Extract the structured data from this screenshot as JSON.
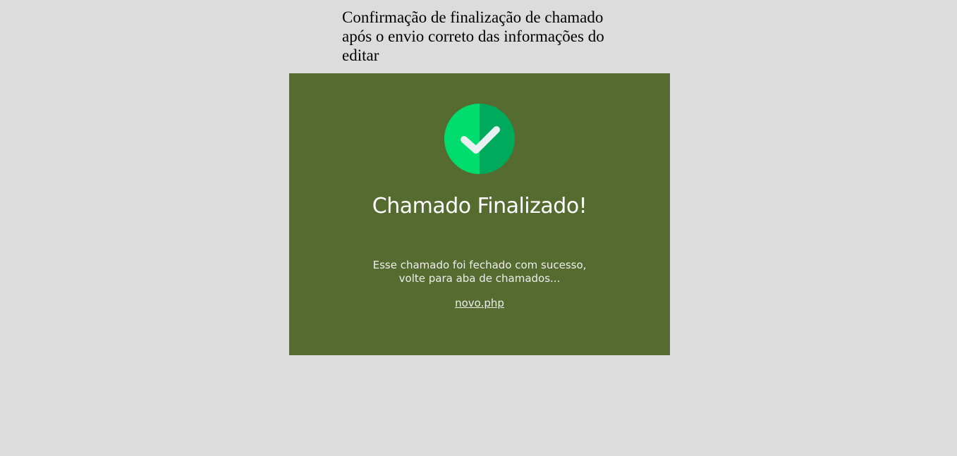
{
  "page": {
    "heading": "Confirmação de finalização de chamado após o envio correto das informações do editar"
  },
  "card": {
    "icon": "check-circle-icon",
    "title": "Chamado Finalizado!",
    "message_line1": "Esse chamado foi fechado com sucesso,",
    "message_line2": "volte para aba de chamados...",
    "link_text": "novo.php"
  },
  "colors": {
    "page_background": "#dcdcdc",
    "card_background": "#556b2f",
    "icon_green_light": "#00dc6e",
    "icon_green_dark": "#00aa5c",
    "checkmark": "#e8f0f0"
  }
}
